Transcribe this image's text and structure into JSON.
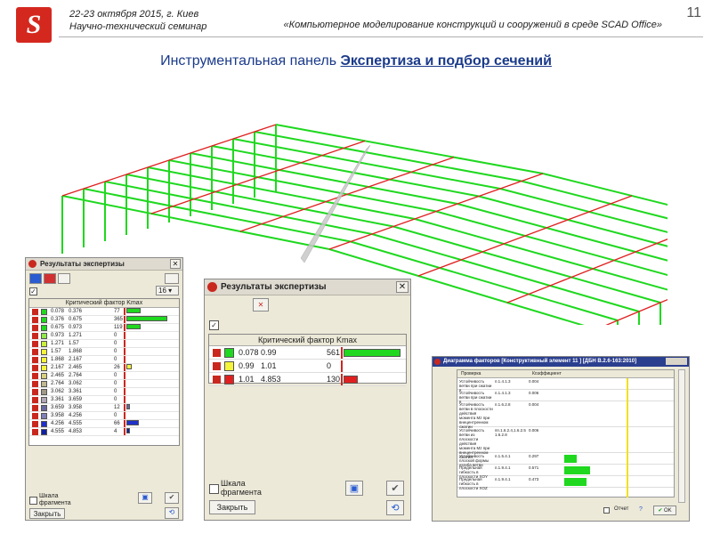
{
  "header": {
    "date_line": "22-23 октября 2015, г. Киев",
    "seminar": "Научно-технический семинар",
    "topic": "«Компьютерное моделирование конструкций и сооружений в среде SCAD Office»",
    "page_number": "11"
  },
  "title": {
    "prefix": "Инструментальная панель ",
    "link": "Экспертиза и подбор сечений"
  },
  "colors": {
    "frame": "#1fd81f",
    "purlin": "#e02020",
    "title": "#1a3a8a"
  },
  "small_window": {
    "title": "Результаты экспертизы",
    "spin_value": "16",
    "header": "Критический фактор Kmax",
    "rows": [
      {
        "from": "0.078",
        "to": "0.376",
        "count": "77",
        "color": "#1fd81f",
        "fill": 0.35
      },
      {
        "from": "0.376",
        "to": "0.675",
        "count": "365",
        "color": "#1fd81f",
        "fill": 1.0
      },
      {
        "from": "0.675",
        "to": "0.973",
        "count": "119",
        "color": "#1fd81f",
        "fill": 0.35
      },
      {
        "from": "0.973",
        "to": "1.271",
        "count": "0",
        "color": "#8fe84a",
        "fill": 0
      },
      {
        "from": "1.271",
        "to": "1.57",
        "count": "0",
        "color": "#c9f03a",
        "fill": 0
      },
      {
        "from": "1.57",
        "to": "1.868",
        "count": "0",
        "color": "#f4f43a",
        "fill": 0
      },
      {
        "from": "1.868",
        "to": "2.167",
        "count": "0",
        "color": "#f4f43a",
        "fill": 0
      },
      {
        "from": "2.167",
        "to": "2.465",
        "count": "26",
        "color": "#f4f43a",
        "fill": 0.12
      },
      {
        "from": "2.465",
        "to": "2.764",
        "count": "0",
        "color": "#d8d080",
        "fill": 0
      },
      {
        "from": "2.764",
        "to": "3.062",
        "count": "0",
        "color": "#c0b890",
        "fill": 0
      },
      {
        "from": "3.062",
        "to": "3.361",
        "count": "0",
        "color": "#a09888",
        "fill": 0
      },
      {
        "from": "3.361",
        "to": "3.659",
        "count": "0",
        "color": "#b0a8b8",
        "fill": 0
      },
      {
        "from": "3.659",
        "to": "3.958",
        "count": "12",
        "color": "#6868a0",
        "fill": 0.05
      },
      {
        "from": "3.958",
        "to": "4.256",
        "count": "0",
        "color": "#8080b8",
        "fill": 0
      },
      {
        "from": "4.256",
        "to": "4.555",
        "count": "66",
        "color": "#2030c8",
        "fill": 0.3
      },
      {
        "from": "4.555",
        "to": "4.853",
        "count": "4",
        "color": "#1020a0",
        "fill": 0.03
      }
    ],
    "scale_label": "Шкала фрагмента",
    "close_label": "Закрыть"
  },
  "big_window": {
    "title": "Результаты экспертизы",
    "header": "Критический фактор Kmax",
    "rows": [
      {
        "from": "0.078",
        "to": "0.99",
        "count": "561",
        "color": "#1fd81f",
        "fill": 1.0
      },
      {
        "from": "0.99",
        "to": "1.01",
        "count": "0",
        "color": "#f4f43a",
        "fill": 0
      },
      {
        "from": "1.01",
        "to": "4.853",
        "count": "130",
        "color": "#e02020",
        "fill": 0.25
      }
    ],
    "scale_label": "Шкала фрагмента",
    "close_label": "Закрыть"
  },
  "diagram_window": {
    "title": "Диаграмма факторов [Конструктивный элемент 11 ] [ДБН В.2.6-163:2010]",
    "col_check": "Проверка",
    "col_coef": "Коэффициент",
    "rows": [
      {
        "check": "Устойчивость ветви при сжатии в",
        "ref": "п.1.4.1.3",
        "value": "0.004",
        "fill": 0.0
      },
      {
        "check": "Устойчивость ветви при сжатии в",
        "ref": "п.1.4.1.3",
        "value": "0.006",
        "fill": 0.0
      },
      {
        "check": "Устойчивость ветви в плоскости действия момента Mz при внецентренном сжатии",
        "ref": "п.1.6.2.8",
        "value": "0.004",
        "fill": 0.0
      },
      {
        "check": "Устойчивость ветви из плоскости действия момента Mz при внецентренном сжатии",
        "ref": "пп.1.6.2.4,1.6.2.5 1.6.2.8",
        "value": "0.006",
        "fill": 0.0
      },
      {
        "check": "Устойчивость плоской формы изгиба ветви",
        "ref": "п.1.5.4.1",
        "value": "0.297",
        "fill": 0.2
      },
      {
        "check": "Предельная гибкость в плоскости XOY",
        "ref": "п.1.9.4.1",
        "value": "0.571",
        "fill": 0.42
      },
      {
        "check": "Предельная гибкость в плоскости XOZ",
        "ref": "п.1.9.4.1",
        "value": "0.473",
        "fill": 0.35
      }
    ],
    "report_label": "Отчет",
    "ok_label": "OK"
  }
}
